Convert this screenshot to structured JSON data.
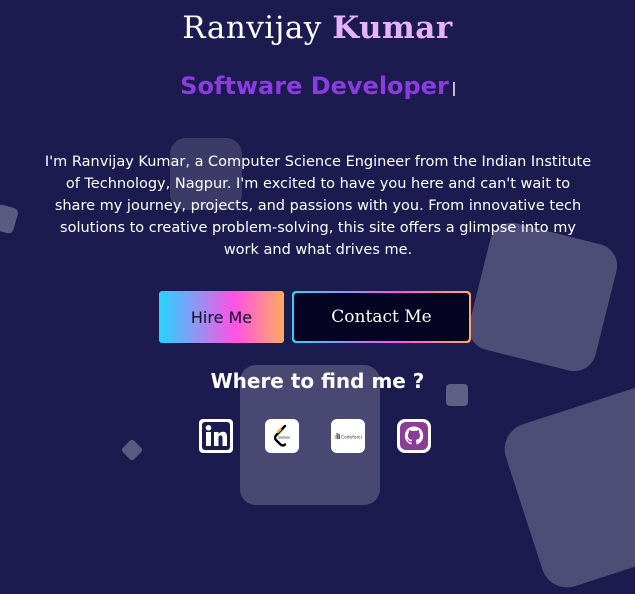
{
  "header": {
    "first_name": "Ranvijay",
    "last_name": "Kumar",
    "role": "Software Developer"
  },
  "intro": {
    "text": "I'm Ranvijay Kumar, a Computer Science Engineer from the Indian Institute of Technology, Nagpur. I'm excited to have you here and can't wait to share my journey, projects, and passions with you. From innovative tech solutions to creative problem-solving, this site offers a glimpse into my work and what drives me."
  },
  "buttons": {
    "hire_label": "Hire Me",
    "contact_label": "Contact Me"
  },
  "find": {
    "heading": "Where to find me ?",
    "links": [
      {
        "icon": "linkedin-icon"
      },
      {
        "icon": "leetcode-icon"
      },
      {
        "icon": "codeforces-icon",
        "text": "Codeforces"
      },
      {
        "icon": "github-icon"
      }
    ]
  },
  "colors": {
    "background": "#1c1b50",
    "accent_last_name": "#e6b2ff",
    "accent_role": "#8a3ce0",
    "gradient": [
      "#23d5ff",
      "#ff52e5",
      "#ffab63"
    ]
  }
}
